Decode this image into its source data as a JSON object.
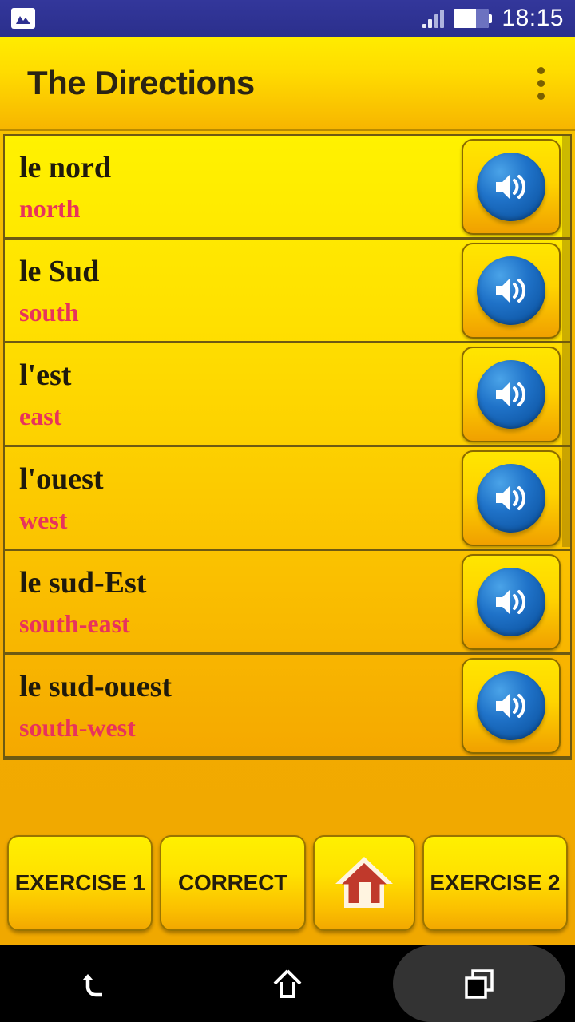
{
  "status_bar": {
    "notification_icon": "gallery-image-icon",
    "signal_icon": "cellular-signal-icon",
    "battery_icon": "battery-icon",
    "time": "18:15"
  },
  "app_bar": {
    "title": "The Directions",
    "overflow_icon": "overflow-menu-icon"
  },
  "list": {
    "speaker_icon": "speaker-volume-icon",
    "items": [
      {
        "word": "le nord",
        "translation": "north"
      },
      {
        "word": "le Sud",
        "translation": "south"
      },
      {
        "word": "l'est",
        "translation": "east"
      },
      {
        "word": "l'ouest",
        "translation": "west"
      },
      {
        "word": "le sud-Est",
        "translation": "south-east"
      },
      {
        "word": "le sud-ouest",
        "translation": "south-west"
      }
    ]
  },
  "bottom_buttons": [
    {
      "label": "EXERCISE 1",
      "icon": null
    },
    {
      "label": "CORRECT",
      "icon": null
    },
    {
      "label": "",
      "icon": "home-house-icon"
    },
    {
      "label": "EXERCISE 2",
      "icon": null
    }
  ],
  "nav_bar": {
    "back_icon": "back-arrow-icon",
    "home_icon": "home-outline-icon",
    "recents_icon": "recent-apps-icon"
  },
  "colors": {
    "status_bar": "#2e3192",
    "app_bar_top": "#ffec00",
    "app_bar_bottom": "#f7b500",
    "list_top": "#fff200",
    "list_bottom": "#f5a800",
    "word_text": "#1f1a0c",
    "translation_text": "#e8335c",
    "speaker_blue": "#1f72c8",
    "home_red": "#c0392b",
    "nav_bar": "#000000"
  }
}
